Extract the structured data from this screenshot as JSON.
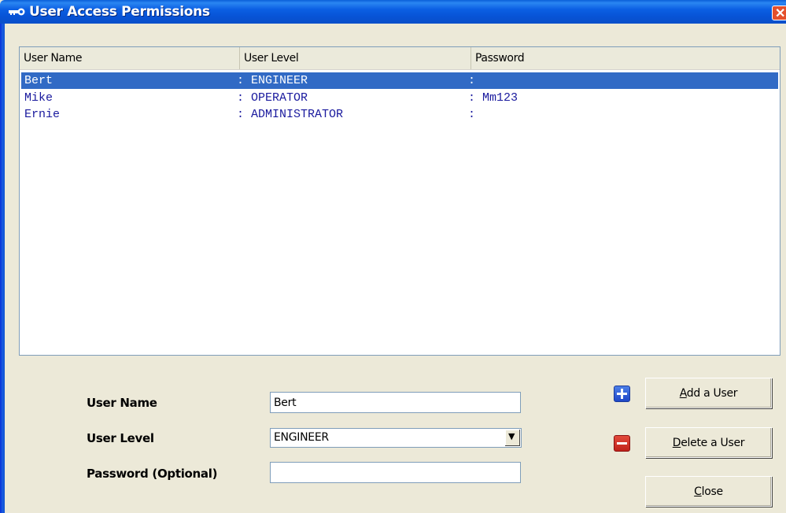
{
  "window": {
    "title": "User Access Permissions",
    "title_icon": "key-icon",
    "close_icon": "close-icon"
  },
  "list": {
    "columns": [
      "User Name",
      "User Level",
      "Password"
    ],
    "rows": [
      {
        "name": "Bert",
        "level": ": ENGINEER",
        "password": ":",
        "selected": true
      },
      {
        "name": "Mike",
        "level": ": OPERATOR",
        "password": ": Mm123",
        "selected": false
      },
      {
        "name": "Ernie",
        "level": ": ADMINISTRATOR",
        "password": ":",
        "selected": false
      }
    ]
  },
  "form": {
    "user_name_label": "User Name",
    "user_name_value": "Bert",
    "user_level_label": "User Level",
    "user_level_value": "ENGINEER",
    "password_label": "Password (Optional)",
    "password_value": ""
  },
  "buttons": {
    "add_rest": "dd a User",
    "add_mnemonic": "A",
    "delete_rest": "elete a User",
    "delete_mnemonic": "D",
    "close_rest": "lose",
    "close_mnemonic": "C"
  },
  "colors": {
    "selection": "#316ac5",
    "list_text": "#1a1a9e",
    "add_icon": "#2f5fd8",
    "delete_icon": "#d43325"
  }
}
